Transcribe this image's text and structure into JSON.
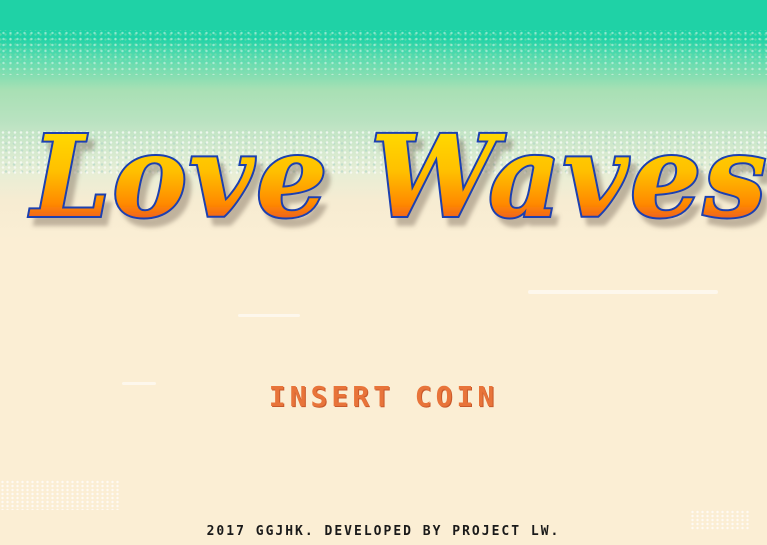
{
  "game": {
    "title": "Love Waves",
    "prompt": "INSERT COIN",
    "copyright": "2017 GGJHK. DEVELOPED BY PROJECT LW."
  },
  "colors": {
    "sea": "#1fd2a6",
    "sand": "#fbeed4",
    "prompt_text": "#e8743a",
    "logo_top": "#ffe600",
    "logo_mid": "#ff8a00",
    "logo_bottom": "#d6204a",
    "logo_outline": "#1a3fb0",
    "copyright_text": "#1a1a1a"
  },
  "icons": [
    "title-logo"
  ]
}
